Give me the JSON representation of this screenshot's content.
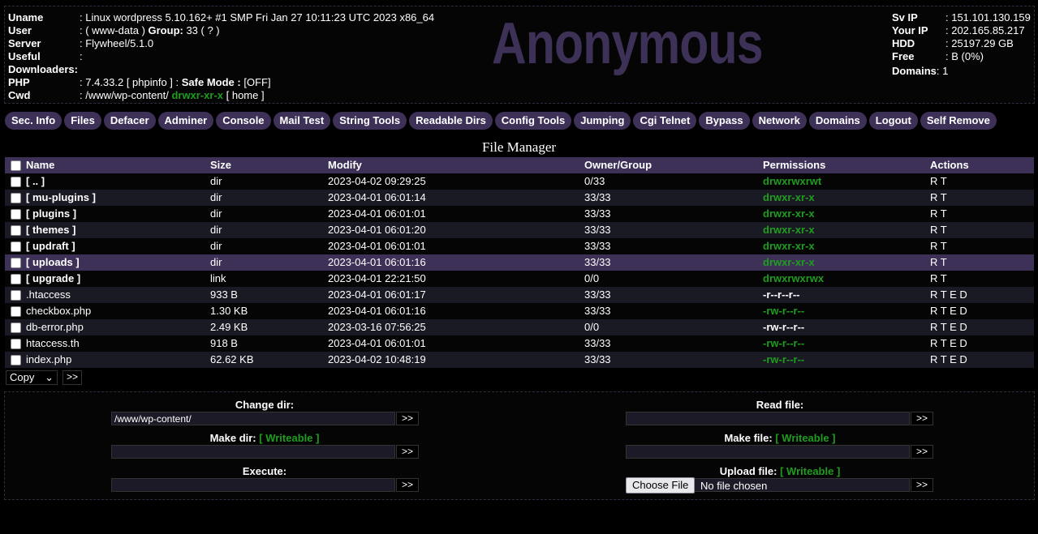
{
  "header": {
    "uname_label": "Uname",
    "uname": ": Linux wordpress 5.10.162+ #1 SMP Fri Jan 27 10:11:23 UTC 2023 x86_64",
    "user_label": "User",
    "user_pre": ": ( www-data ) ",
    "group_label": "Group:",
    "group_val": " 33 ( ? )",
    "server_label": "Server",
    "server": ": Flywheel/5.1.0",
    "useful_label": "Useful",
    "useful": ":",
    "downloaders_label": "Downloaders:",
    "downloaders": "",
    "php_label": "PHP",
    "php": ": 7.4.33.2 [ phpinfo ] : ",
    "safe_mode_label": "Safe Mode :",
    "safe_mode": " [OFF]",
    "cwd_label": "Cwd",
    "cwd": ": /www/wp-content/ ",
    "cwd_perm": "drwxr-xr-x",
    "cwd_home": " [ home ]",
    "logo": "Anonymous",
    "sv_ip_label": "Sv IP",
    "sv_ip": ": 151.101.130.159",
    "your_ip_label": "Your IP",
    "your_ip": ": 202.165.85.217",
    "hdd_label": "HDD",
    "hdd": ": 25197.29 GB",
    "free_label": "Free",
    "free": ": B (0%)",
    "domains_label": "Domains",
    "domains": ": 1"
  },
  "menu": [
    "Sec. Info",
    "Files",
    "Defacer",
    "Adminer",
    "Console",
    "Mail Test",
    "String Tools",
    "Readable Dirs",
    "Config Tools",
    "Jumping",
    "Cgi Telnet",
    "Bypass",
    "Network",
    "Domains",
    "Logout",
    "Self Remove"
  ],
  "file_manager": {
    "title": "File Manager",
    "columns": [
      "Name",
      "Size",
      "Modify",
      "Owner/Group",
      "Permissions",
      "Actions"
    ],
    "rows": [
      {
        "name": "[ .. ]",
        "size": "dir",
        "modify": "2023-04-02 09:29:25",
        "owner": "0/33",
        "perm": "drwxrwxrwt",
        "perm_color": "green",
        "actions": "R T"
      },
      {
        "name": "[ mu-plugins ]",
        "size": "dir",
        "modify": "2023-04-01 06:01:14",
        "owner": "33/33",
        "perm": "drwxr-xr-x",
        "perm_color": "green",
        "actions": "R T"
      },
      {
        "name": "[ plugins ]",
        "size": "dir",
        "modify": "2023-04-01 06:01:01",
        "owner": "33/33",
        "perm": "drwxr-xr-x",
        "perm_color": "green",
        "actions": "R T"
      },
      {
        "name": "[ themes ]",
        "size": "dir",
        "modify": "2023-04-01 06:01:20",
        "owner": "33/33",
        "perm": "drwxr-xr-x",
        "perm_color": "green",
        "actions": "R T"
      },
      {
        "name": "[ updraft ]",
        "size": "dir",
        "modify": "2023-04-01 06:01:01",
        "owner": "33/33",
        "perm": "drwxr-xr-x",
        "perm_color": "green",
        "actions": "R T"
      },
      {
        "name": "[ uploads ]",
        "size": "dir",
        "modify": "2023-04-01 06:01:16",
        "owner": "33/33",
        "perm": "drwxr-xr-x",
        "perm_color": "green",
        "actions": "R T"
      },
      {
        "name": "[ upgrade ]",
        "size": "link",
        "modify": "2023-04-01 22:21:50",
        "owner": "0/0",
        "perm": "drwxrwxrwx",
        "perm_color": "green",
        "actions": "R T"
      },
      {
        "name": ".htaccess",
        "size": "933 B",
        "modify": "2023-04-01 06:01:17",
        "owner": "33/33",
        "perm": "-r--r--r--",
        "perm_color": "white",
        "actions": "R T E D"
      },
      {
        "name": "checkbox.php",
        "size": "1.30 KB",
        "modify": "2023-04-01 06:01:16",
        "owner": "33/33",
        "perm": "-rw-r--r--",
        "perm_color": "green",
        "actions": "R T E D"
      },
      {
        "name": "db-error.php",
        "size": "2.49 KB",
        "modify": "2023-03-16 07:56:25",
        "owner": "0/0",
        "perm": "-rw-r--r--",
        "perm_color": "white",
        "actions": "R T E D"
      },
      {
        "name": "htaccess.th",
        "size": "918 B",
        "modify": "2023-04-01 06:01:01",
        "owner": "33/33",
        "perm": "-rw-r--r--",
        "perm_color": "green",
        "actions": "R T E D"
      },
      {
        "name": "index.php",
        "size": "62.62 KB",
        "modify": "2023-04-02 10:48:19",
        "owner": "33/33",
        "perm": "-rw-r--r--",
        "perm_color": "green",
        "actions": "R T E D"
      }
    ],
    "copy_select": "Copy",
    "go": ">>"
  },
  "tools": {
    "change_dir_label": "Change dir:",
    "change_dir_value": "/www/wp-content/",
    "make_dir_label": "Make dir:",
    "make_dir_status": "[ Writeable ]",
    "execute_label": "Execute:",
    "read_file_label": "Read file:",
    "make_file_label": "Make file:",
    "make_file_status": "[ Writeable ]",
    "upload_file_label": "Upload file:",
    "upload_file_status": "[ Writeable ]",
    "choose_file": "Choose File",
    "no_file": "No file chosen",
    "go": ">>"
  },
  "colors": {
    "accent": "#3d3158",
    "green": "#1f9d1f",
    "background": "#000000"
  }
}
